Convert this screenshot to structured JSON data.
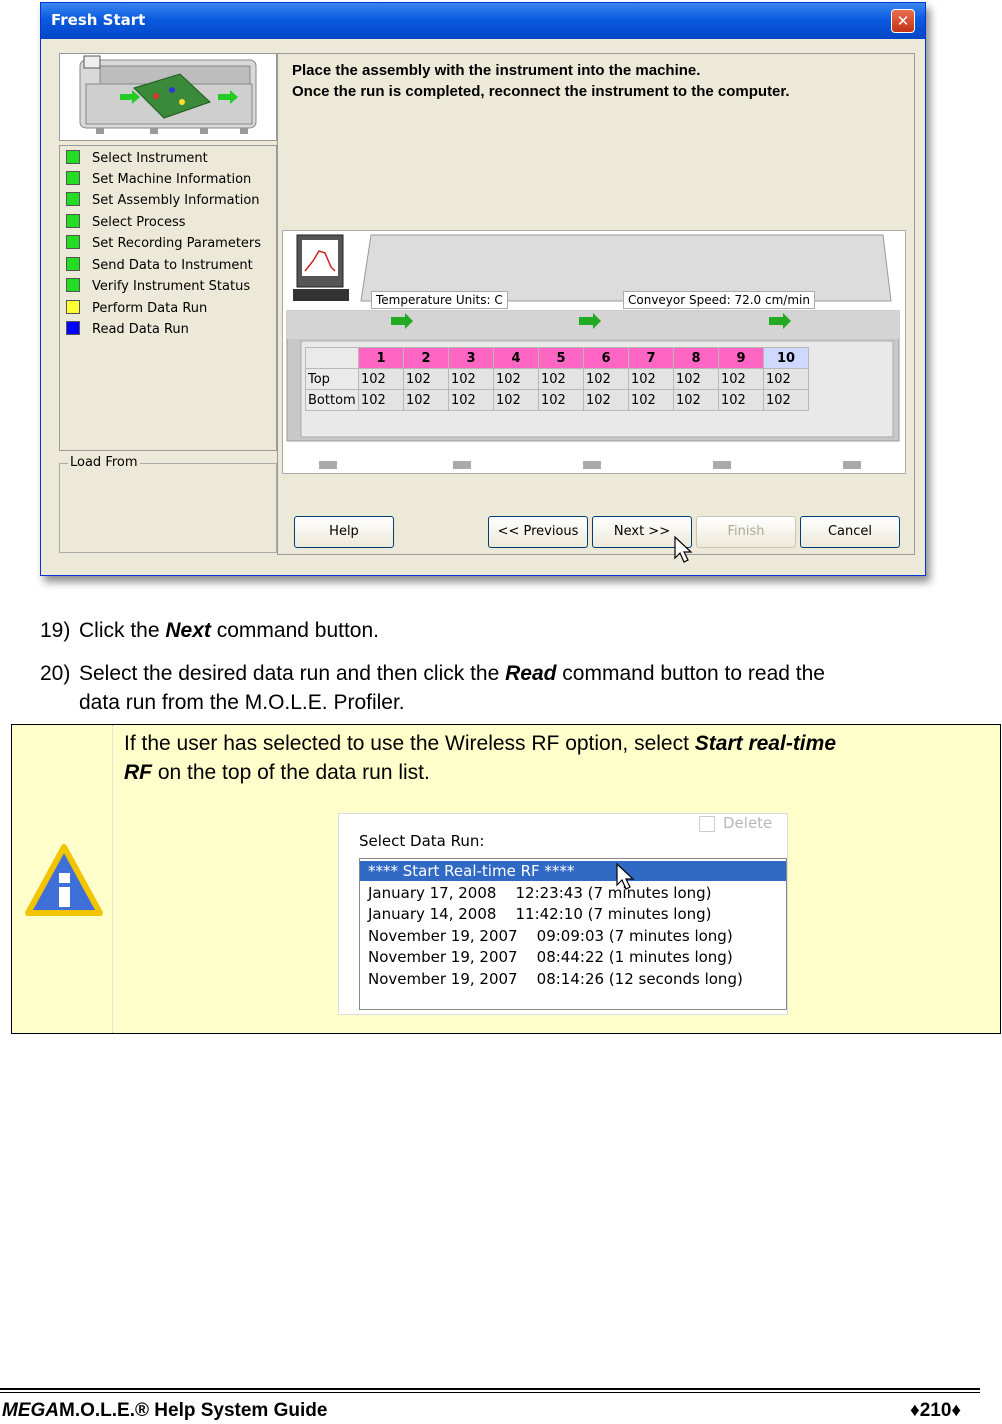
{
  "dialog": {
    "title": "Fresh Start",
    "close_glyph": "✕",
    "instruction_line1": "Place the assembly with the instrument into the machine.",
    "instruction_line2": "Once the run is completed, reconnect the instrument to the computer.",
    "steps": [
      {
        "label": "Select Instrument",
        "color": "#22dd22"
      },
      {
        "label": "Set Machine Information",
        "color": "#22dd22"
      },
      {
        "label": "Set Assembly Information",
        "color": "#22dd22"
      },
      {
        "label": "Select Process",
        "color": "#22dd22"
      },
      {
        "label": "Set Recording Parameters",
        "color": "#22dd22"
      },
      {
        "label": "Send Data to Instrument",
        "color": "#22dd22"
      },
      {
        "label": "Verify Instrument Status",
        "color": "#22dd22"
      },
      {
        "label": "Perform Data Run",
        "color": "#ffff33"
      },
      {
        "label": "Read Data Run",
        "color": "#0000ff"
      }
    ],
    "load_from_label": "Load From",
    "temperature_units": "Temperature Units: C",
    "conveyor_speed": "Conveyor Speed: 72.0  cm/min",
    "zones": [
      "1",
      "2",
      "3",
      "4",
      "5",
      "6",
      "7",
      "8",
      "9",
      "10"
    ],
    "top_label": "Top",
    "bottom_label": "Bottom",
    "top_values": [
      "102",
      "102",
      "102",
      "102",
      "102",
      "102",
      "102",
      "102",
      "102",
      "102"
    ],
    "bottom_values": [
      "102",
      "102",
      "102",
      "102",
      "102",
      "102",
      "102",
      "102",
      "102",
      "102"
    ],
    "buttons": {
      "help": "Help",
      "previous": "<< Previous",
      "next": "Next >>",
      "finish": "Finish",
      "cancel": "Cancel"
    }
  },
  "steps_text": {
    "s19_num": "19)",
    "s19_a": "Click the ",
    "s19_b": "Next",
    "s19_c": " command button.",
    "s20_num": "20)",
    "s20_a": "Select the desired data run and then click the ",
    "s20_b": "Read",
    "s20_c": " command button to read the",
    "s20_d": "data run from the M.O.L.E. Profiler."
  },
  "note": {
    "text_a": "If the user has selected to use the Wireless RF option, select ",
    "text_b1": "Start real-time",
    "text_b2": "RF",
    "text_c": " on the top of the data run list.",
    "select_label": "Select Data Run:",
    "delete_label": "Delete",
    "runs": [
      "**** Start Real-time RF ****",
      "January 17, 2008    12:23:43 (7 minutes long)",
      "January 14, 2008    11:42:10 (7 minutes long)",
      "November 19, 2007    09:09:03 (7 minutes long)",
      "November 19, 2007    08:44:22 (1 minutes long)",
      "November 19, 2007    08:14:26 (12 seconds long)"
    ]
  },
  "footer": {
    "brand_italic": "MEGA",
    "brand_rest": "M.O.L.E.® Help System Guide",
    "page": "♦210♦"
  }
}
